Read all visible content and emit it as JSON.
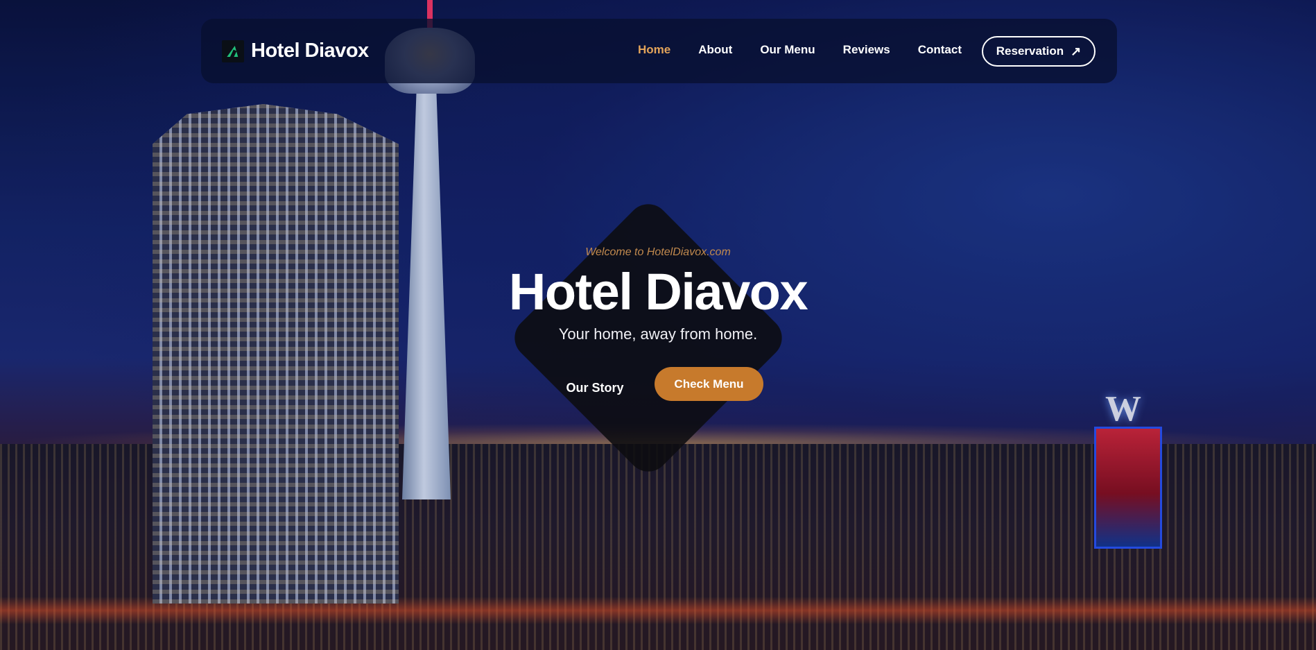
{
  "brand": {
    "name": "Hotel Diavox",
    "accent_color": "#c77a2c",
    "logo_icon": "logo-mark-icon"
  },
  "nav": {
    "items": [
      {
        "label": "Home",
        "active": true
      },
      {
        "label": "About",
        "active": false
      },
      {
        "label": "Our Menu",
        "active": false
      },
      {
        "label": "Reviews",
        "active": false
      },
      {
        "label": "Contact",
        "active": false
      }
    ],
    "active_color": "#e3a45a",
    "reservation": {
      "label": "Reservation",
      "icon": "arrow-up-right-icon",
      "glyph": "↗"
    }
  },
  "hero": {
    "welcome": "Welcome to HotelDiavox.com",
    "title": "Hotel Diavox",
    "tagline": "Your home, away from home.",
    "buttons": {
      "our_story": "Our Story",
      "check_menu": "Check Menu"
    }
  }
}
